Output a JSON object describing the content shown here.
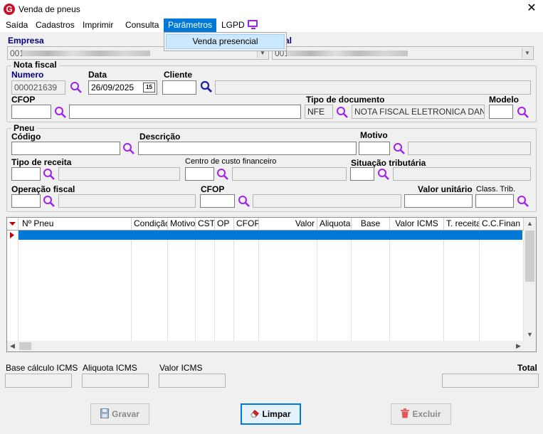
{
  "window": {
    "title": "Venda de pneus",
    "close_glyph": "✕",
    "logo_letter": "G"
  },
  "menu": {
    "items": [
      "Saída",
      "Cadastros",
      "Imprimir",
      "Consulta",
      "Parâmetros",
      "LGPD"
    ],
    "active": "Parâmetros",
    "dropdown_item": "Venda presencial"
  },
  "empresa": {
    "label": "Empresa",
    "code": "001",
    "right_label_fragment": "al",
    "right_code": "001"
  },
  "nota_fiscal": {
    "legend": "Nota fiscal",
    "numero_label": "Numero",
    "numero_value": "000021639",
    "data_label": "Data",
    "data_value": "26/09/2025",
    "calendar_day": "15",
    "cliente_label": "Cliente",
    "cfop_label": "CFOP",
    "tipo_documento_label": "Tipo de documento",
    "tipo_documento_code": "NFE",
    "tipo_documento_desc": "NOTA FISCAL ELETRONICA DANFE",
    "modelo_label": "Modelo"
  },
  "pneu": {
    "legend": "Pneu",
    "codigo_label": "Código",
    "descricao_label": "Descrição",
    "motivo_label": "Motivo",
    "tipo_receita_label": "Tipo de receita",
    "centro_custo_label": "Centro de custo financeiro",
    "situacao_tributaria_label": "Situação tributária",
    "operacao_fiscal_label": "Operação fiscal",
    "cfop_label": "CFOP",
    "valor_unitario_label": "Valor unitário",
    "class_trib_label": "Class. Trib."
  },
  "grid": {
    "columns": [
      "Nº Pneu",
      "Condição",
      "Motivo",
      "CST",
      "OP",
      "CFOP",
      "Valor",
      "Aliquota",
      "Base",
      "Valor ICMS",
      "T. receita",
      "C.C.Finan"
    ]
  },
  "totals": {
    "base_label": "Base cálculo ICMS",
    "aliquota_label": "Aliquota ICMS",
    "valor_label": "Valor ICMS",
    "total_label": "Total"
  },
  "buttons": {
    "gravar": "Gravar",
    "limpar": "Limpar",
    "excluir": "Excluir"
  },
  "colors": {
    "accent": "#0078d7",
    "search_icon": "#a020f0",
    "label_navy": "#000080"
  }
}
